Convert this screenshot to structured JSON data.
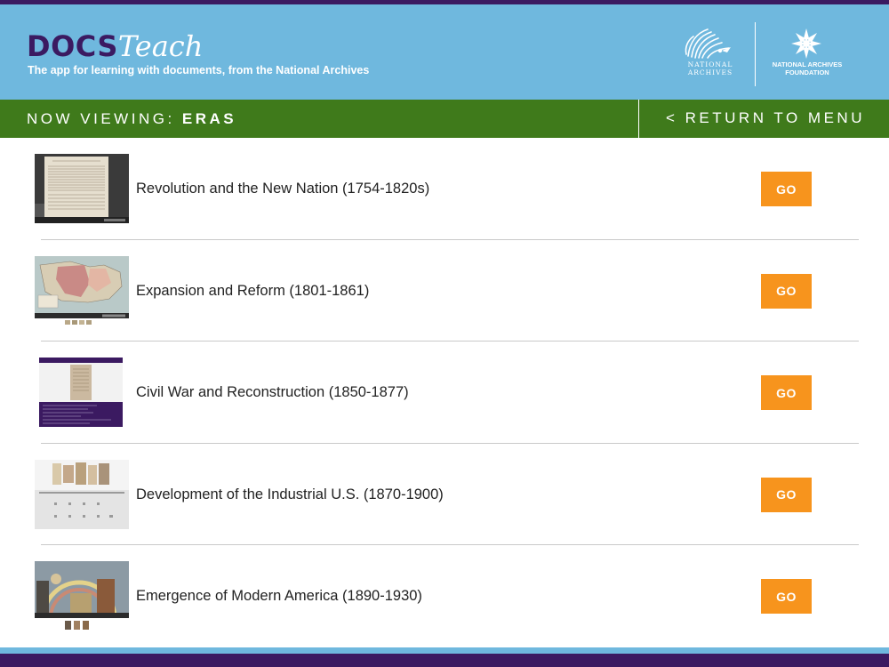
{
  "header": {
    "logo_docs": "DOCS",
    "logo_teach": "Teach",
    "tagline": "The app for learning with documents, from the National Archives",
    "na_logo_line1": "NATIONAL",
    "na_logo_line2": "ARCHIVES",
    "naf_logo_line1": "NATIONAL ARCHIVES",
    "naf_logo_line2": "FOUNDATION"
  },
  "nav": {
    "now_viewing_label": "NOW VIEWING:",
    "now_viewing_value": "ERAS",
    "return_label": "< RETURN TO MENU"
  },
  "eras": [
    {
      "title": "Revolution and the New Nation (1754-1820s)",
      "button": "GO",
      "thumbnail": "declaration-document-thumbnail"
    },
    {
      "title": "Expansion and Reform (1801-1861)",
      "button": "GO",
      "thumbnail": "territory-map-thumbnail"
    },
    {
      "title": "Civil War and Reconstruction (1850-1877)",
      "button": "GO",
      "thumbnail": "activity-list-thumbnail"
    },
    {
      "title": "Development of the Industrial U.S. (1870-1900)",
      "button": "GO",
      "thumbnail": "image-sorting-thumbnail"
    },
    {
      "title": "Emergence of Modern America (1890-1930)",
      "button": "GO",
      "thumbnail": "painting-thumbnail"
    }
  ],
  "colors": {
    "header_bg": "#6fb8de",
    "nav_bg": "#3f7a1b",
    "brand_purple": "#3b1a61",
    "go_button": "#f7941d"
  }
}
